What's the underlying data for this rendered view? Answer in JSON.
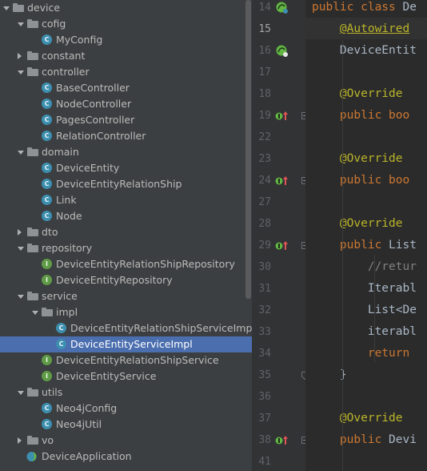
{
  "tree": {
    "items": [
      {
        "label": "device",
        "type": "folder",
        "depth": 0,
        "expanded": true
      },
      {
        "label": "cofig",
        "type": "folder",
        "depth": 1,
        "expanded": true
      },
      {
        "label": "MyConfig",
        "type": "class",
        "depth": 2
      },
      {
        "label": "constant",
        "type": "folder",
        "depth": 1,
        "expanded": false
      },
      {
        "label": "controller",
        "type": "folder",
        "depth": 1,
        "expanded": true
      },
      {
        "label": "BaseController",
        "type": "class",
        "depth": 2
      },
      {
        "label": "NodeController",
        "type": "class",
        "depth": 2
      },
      {
        "label": "PagesController",
        "type": "class",
        "depth": 2
      },
      {
        "label": "RelationController",
        "type": "class",
        "depth": 2
      },
      {
        "label": "domain",
        "type": "folder",
        "depth": 1,
        "expanded": true
      },
      {
        "label": "DeviceEntity",
        "type": "class",
        "depth": 2
      },
      {
        "label": "DeviceEntityRelationShip",
        "type": "class",
        "depth": 2
      },
      {
        "label": "Link",
        "type": "class",
        "depth": 2
      },
      {
        "label": "Node",
        "type": "class",
        "depth": 2
      },
      {
        "label": "dto",
        "type": "folder",
        "depth": 1,
        "expanded": false
      },
      {
        "label": "repository",
        "type": "folder",
        "depth": 1,
        "expanded": true
      },
      {
        "label": "DeviceEntityRelationShipRepository",
        "type": "interface",
        "depth": 2
      },
      {
        "label": "DeviceEntityRepository",
        "type": "interface",
        "depth": 2
      },
      {
        "label": "service",
        "type": "folder",
        "depth": 1,
        "expanded": true
      },
      {
        "label": "impl",
        "type": "folder",
        "depth": 2,
        "expanded": true
      },
      {
        "label": "DeviceEntityRelationShipServiceImpl",
        "type": "class",
        "depth": 3
      },
      {
        "label": "DeviceEntityServiceImpl",
        "type": "class",
        "depth": 3,
        "selected": true
      },
      {
        "label": "DeviceEntityRelationShipService",
        "type": "interface",
        "depth": 2
      },
      {
        "label": "DeviceEntityService",
        "type": "interface",
        "depth": 2
      },
      {
        "label": "utils",
        "type": "folder",
        "depth": 1,
        "expanded": true
      },
      {
        "label": "Neo4jConfig",
        "type": "class",
        "depth": 2
      },
      {
        "label": "Neo4jUtil",
        "type": "class",
        "depth": 2
      },
      {
        "label": "vo",
        "type": "folder",
        "depth": 1,
        "expanded": false
      },
      {
        "label": "DeviceApplication",
        "type": "app",
        "depth": 1
      }
    ]
  },
  "icon_glyphs": {
    "class": "C",
    "interface": "I"
  },
  "editor": {
    "current_line": "15",
    "lines": [
      {
        "num": "14",
        "gutter": "bean-icon",
        "segments": [
          {
            "t": "public class ",
            "c": "kw"
          },
          {
            "t": "De",
            "c": "plain"
          }
        ]
      },
      {
        "num": "15",
        "gutter": "",
        "segments": [
          {
            "t": "    ",
            "c": "plain"
          },
          {
            "t": "@Autowired",
            "c": "ann"
          }
        ]
      },
      {
        "num": "16",
        "gutter": "autowired-icon",
        "segments": [
          {
            "t": "    DeviceEntit",
            "c": "plain"
          }
        ]
      },
      {
        "num": "17",
        "gutter": "",
        "segments": []
      },
      {
        "num": "18",
        "gutter": "",
        "segments": [
          {
            "t": "    ",
            "c": "plain"
          },
          {
            "t": "@Override",
            "c": "ann"
          }
        ]
      },
      {
        "num": "19",
        "gutter": "override-icon",
        "fold": "start",
        "segments": [
          {
            "t": "    ",
            "c": "plain"
          },
          {
            "t": "public boo",
            "c": "kw"
          }
        ]
      },
      {
        "num": "22",
        "gutter": "",
        "segments": []
      },
      {
        "num": "23",
        "gutter": "",
        "segments": [
          {
            "t": "    ",
            "c": "plain"
          },
          {
            "t": "@Override",
            "c": "ann"
          }
        ]
      },
      {
        "num": "24",
        "gutter": "override-icon",
        "fold": "start",
        "segments": [
          {
            "t": "    ",
            "c": "plain"
          },
          {
            "t": "public boo",
            "c": "kw"
          }
        ]
      },
      {
        "num": "27",
        "gutter": "",
        "segments": []
      },
      {
        "num": "28",
        "gutter": "",
        "segments": [
          {
            "t": "    ",
            "c": "plain"
          },
          {
            "t": "@Override",
            "c": "ann"
          }
        ]
      },
      {
        "num": "29",
        "gutter": "override-icon",
        "fold": "start",
        "segments": [
          {
            "t": "    ",
            "c": "plain"
          },
          {
            "t": "public ",
            "c": "kw"
          },
          {
            "t": "List",
            "c": "plain"
          }
        ]
      },
      {
        "num": "30",
        "gutter": "",
        "segments": [
          {
            "t": "        ",
            "c": "plain"
          },
          {
            "t": "//retur",
            "c": "cmt"
          }
        ]
      },
      {
        "num": "31",
        "gutter": "",
        "segments": [
          {
            "t": "        Iterabl",
            "c": "plain"
          }
        ]
      },
      {
        "num": "32",
        "gutter": "",
        "segments": [
          {
            "t": "        List<De",
            "c": "plain"
          }
        ]
      },
      {
        "num": "33",
        "gutter": "",
        "segments": [
          {
            "t": "        iterabl",
            "c": "plain"
          }
        ]
      },
      {
        "num": "34",
        "gutter": "",
        "segments": [
          {
            "t": "        ",
            "c": "plain"
          },
          {
            "t": "return",
            "c": "kw"
          }
        ]
      },
      {
        "num": "35",
        "gutter": "",
        "fold": "end",
        "segments": [
          {
            "t": "    }",
            "c": "plain"
          }
        ]
      },
      {
        "num": "36",
        "gutter": "",
        "segments": []
      },
      {
        "num": "37",
        "gutter": "",
        "segments": [
          {
            "t": "    ",
            "c": "plain"
          },
          {
            "t": "@Override",
            "c": "ann"
          }
        ]
      },
      {
        "num": "38",
        "gutter": "override-icon",
        "fold": "start",
        "segments": [
          {
            "t": "    ",
            "c": "plain"
          },
          {
            "t": "public ",
            "c": "kw"
          },
          {
            "t": "Devi",
            "c": "plain"
          }
        ]
      },
      {
        "num": "41",
        "gutter": "",
        "segments": []
      }
    ]
  },
  "colors": {
    "tree_bg": "#3c3f41",
    "selection": "#4b6eaf",
    "editor_bg": "#2b2b2b",
    "gutter_bg": "#313335",
    "keyword": "#cc7832",
    "annotation": "#bbb529",
    "comment": "#808080",
    "text": "#a9b7c6"
  }
}
